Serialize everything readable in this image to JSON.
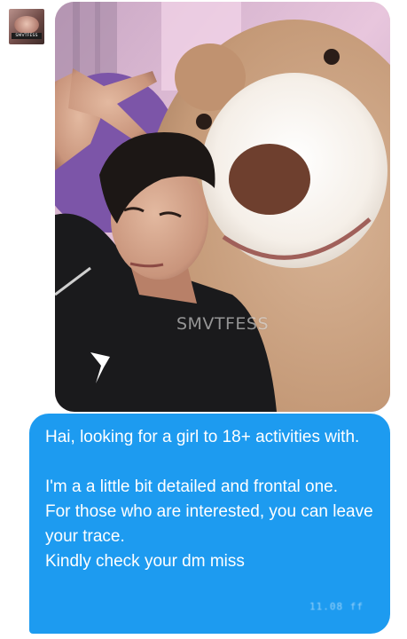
{
  "header": {
    "avatar_icon": "profile-avatar-icon",
    "avatar_tag": "SMVTFESS"
  },
  "media": {
    "watermark": "SMVTFESS"
  },
  "message": {
    "paragraph_1": "Hai, looking for a girl to 18+ activities with.",
    "paragraph_2_lines": [
      "I'm a a little bit detailed and frontal one.",
      "For those who are interested, you can leave your trace.",
      "Kindly check your dm miss"
    ],
    "timestamp": "11.08 ff"
  },
  "colors": {
    "bubble": "#1d9bf0",
    "background": "#ffffff",
    "text": "#ffffff"
  }
}
